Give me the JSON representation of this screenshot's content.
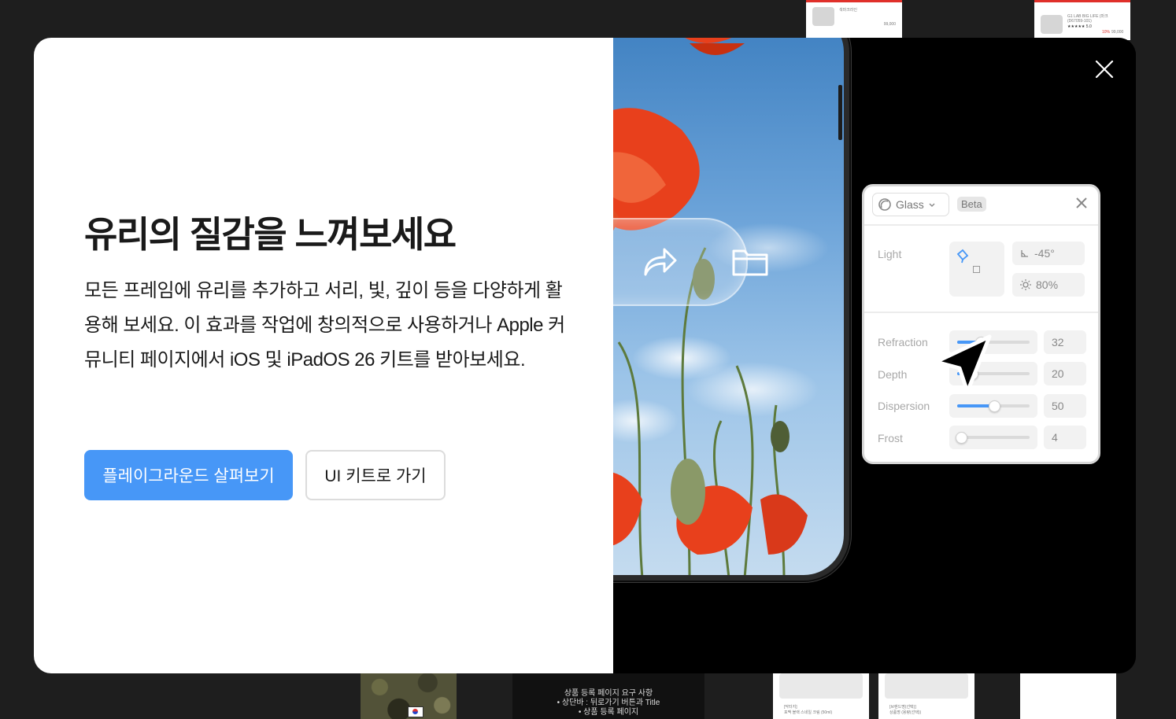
{
  "background": {
    "top_card_1": {
      "title": "색마크라인",
      "price": "99,000"
    },
    "top_card_2": {
      "line1": "G1 LAB BIG LIFE (마크",
      "line2": "(D67059-101)",
      "rating": "★★★★★ 5.0",
      "discount": "10%",
      "price": "99,000"
    },
    "doc_title": "상품 등록 페이지 요구 사항",
    "doc_items": [
      "• 상단바 : 뒤로가기 버튼과 Title",
      "• 상품 등록 페이지"
    ],
    "bottom_card_1": "[닥터지]\n포맥 블랙 스네일 크림 (50ml)",
    "bottom_card_2": "[브랜드명(선택)]\n상품명 (용량(선택))"
  },
  "modal": {
    "title": "유리의 질감을 느껴보세요",
    "description": "모든 프레임에 유리를 추가하고 서리, 빛, 깊이 등을 다양하게 활용해 보세요. 이 효과를 작업에 창의적으로 사용하거나 Apple 커뮤니티 페이지에서 iOS 및 iPadOS 26 키트를 받아보세요.",
    "primary_button": "플레이그라운드 살펴보기",
    "secondary_button": "UI 키트로 가기",
    "close_icon": "close-icon"
  },
  "glass_panel": {
    "effect": "Glass",
    "badge": "Beta",
    "light_label": "Light",
    "light_angle": "-45°",
    "light_intensity": "80%",
    "sliders": [
      {
        "label": "Refraction",
        "value": "32",
        "fraction": 0.32
      },
      {
        "label": "Depth",
        "value": "20",
        "fraction": 0.2
      },
      {
        "label": "Dispersion",
        "value": "50",
        "fraction": 0.5
      },
      {
        "label": "Frost",
        "value": "4",
        "fraction": 0.04
      }
    ]
  },
  "colors": {
    "primary": "#4797f7",
    "poppy": "#e8401c",
    "canvas_bg": "#1e1e1e"
  }
}
